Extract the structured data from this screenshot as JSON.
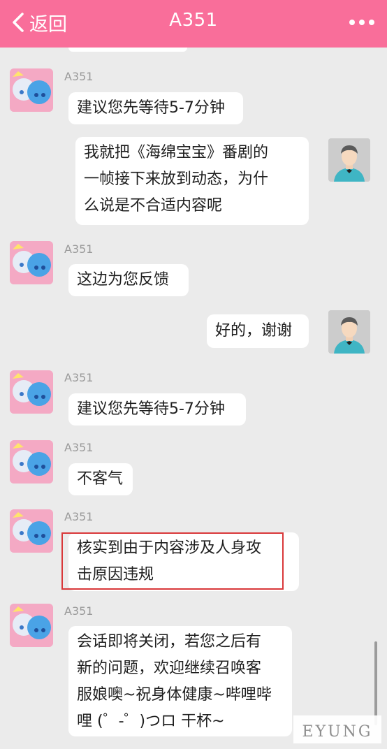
{
  "header": {
    "back_label": "返回",
    "title": "A351"
  },
  "messages": [
    {
      "from": "bot",
      "sender": "A351",
      "lines": [
        "建议您先等待5-7分钟"
      ]
    },
    {
      "from": "user",
      "lines": [
        "我就把《海绵宝宝》番剧的",
        "一帧接下来放到动态，为什",
        "么说是不合适内容呢"
      ]
    },
    {
      "from": "bot",
      "sender": "A351",
      "lines": [
        "这边为您反馈"
      ]
    },
    {
      "from": "user",
      "lines": [
        "好的，谢谢"
      ]
    },
    {
      "from": "bot",
      "sender": "A351",
      "lines": [
        "建议您先等待5-7分钟"
      ]
    },
    {
      "from": "bot",
      "sender": "A351",
      "lines": [
        "不客气"
      ]
    },
    {
      "from": "bot",
      "sender": "A351",
      "lines": [
        "核实到由于内容涉及人身攻",
        "击原因违规"
      ],
      "highlighted": true
    },
    {
      "from": "bot",
      "sender": "A351",
      "lines": [
        "会话即将关闭，若您之后有",
        "新的问题，欢迎继续召唤客",
        "服娘噢~祝身体健康~哔哩哔",
        "哩 (゜-゜)つロ 干杯~"
      ]
    }
  ],
  "watermark": "EYUNG",
  "colors": {
    "header_bg": "#f96e9a",
    "chat_bg": "#ebebeb",
    "bubble_bg": "#ffffff",
    "highlight_border": "#d9383a"
  }
}
